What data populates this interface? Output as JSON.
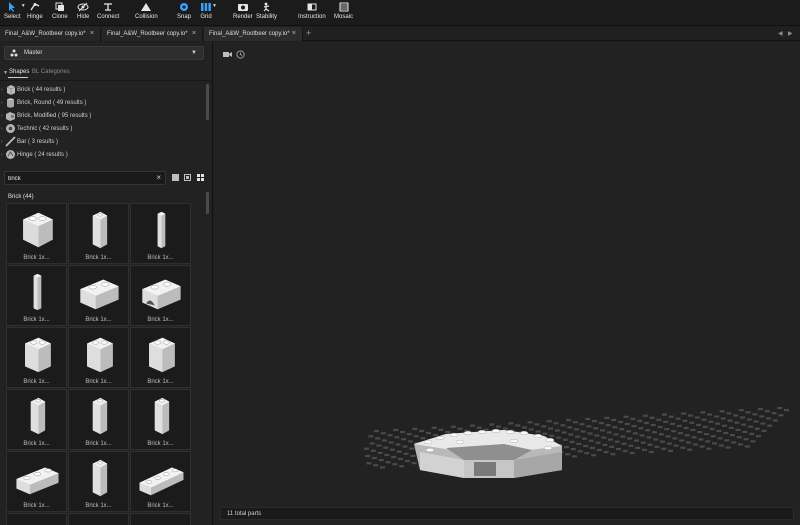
{
  "toolbar": {
    "select": "Select",
    "hinge": "Hinge",
    "clone": "Clone",
    "hide": "Hide",
    "connect": "Connect",
    "collision": "Collision",
    "snap": "Snap",
    "grid": "Grid",
    "render": "Render",
    "stability": "Stability",
    "instruction": "Instruction",
    "mosaic": "Mosaic"
  },
  "tabs": [
    {
      "label": "Final_A&W_Rootbeer copy.io*"
    },
    {
      "label": "Final_A&W_Rootbeer copy.io*"
    },
    {
      "label": "Final_A&W_Rootbeer copy.io*"
    }
  ],
  "left": {
    "master_label": "Master",
    "shapes_tab": "Shapes",
    "bl_tab": "BL Categories",
    "categories": [
      {
        "label": "Brick ( 44 results )",
        "icon": "brick-icon"
      },
      {
        "label": "Brick, Round ( 49 results )",
        "icon": "round-brick-icon"
      },
      {
        "label": "Brick, Modified ( 95 results )",
        "icon": "modified-brick-icon"
      },
      {
        "label": "Technic ( 42 results )",
        "icon": "technic-icon"
      },
      {
        "label": "Bar ( 3 results )",
        "icon": "bar-icon"
      },
      {
        "label": "Hinge ( 24 results )",
        "icon": "hinge-icon"
      }
    ],
    "search": {
      "value": "brick",
      "placeholder": ""
    },
    "result_header": "Brick (44)",
    "parts": [
      {
        "label": "Brick 1x...",
        "shape": "cube"
      },
      {
        "label": "Brick 1x...",
        "shape": "tall"
      },
      {
        "label": "Brick 1x...",
        "shape": "slim"
      },
      {
        "label": "Brick 1x...",
        "shape": "slim"
      },
      {
        "label": "Brick 1x...",
        "shape": "long2"
      },
      {
        "label": "Brick 1x...",
        "shape": "arch"
      },
      {
        "label": "Brick 1x...",
        "shape": "mid"
      },
      {
        "label": "Brick 1x...",
        "shape": "mid"
      },
      {
        "label": "Brick 1x...",
        "shape": "mid"
      },
      {
        "label": "Brick 1x...",
        "shape": "tall"
      },
      {
        "label": "Brick 1x...",
        "shape": "tall"
      },
      {
        "label": "Brick 1x...",
        "shape": "tall"
      },
      {
        "label": "Brick 1x...",
        "shape": "long3"
      },
      {
        "label": "Brick 1x...",
        "shape": "tall"
      },
      {
        "label": "Brick 1x...",
        "shape": "long4"
      }
    ]
  },
  "viewport": {
    "status": "11 total parts"
  },
  "colors": {
    "accent": "#3aa0ff",
    "panel": "#222222",
    "toolbar": "#1b1b1b"
  }
}
